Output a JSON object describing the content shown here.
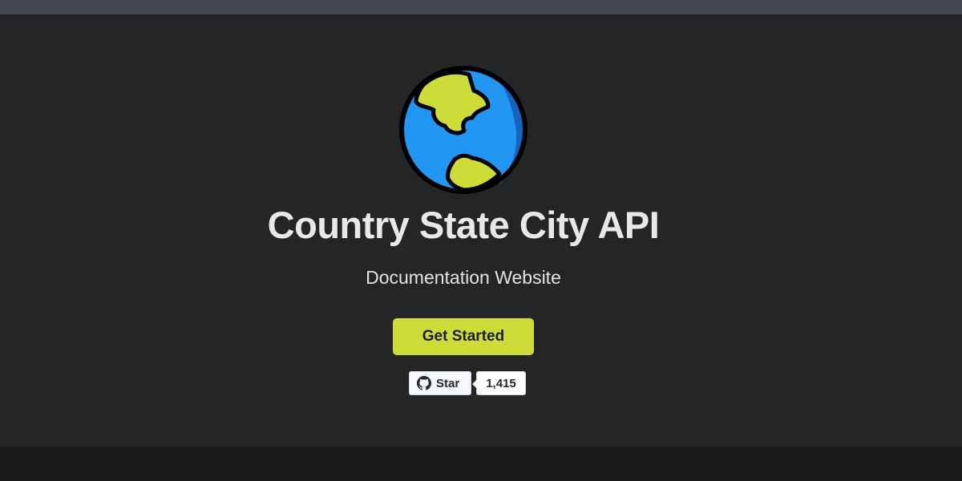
{
  "hero": {
    "title": "Country State City API",
    "subtitle": "Documentation Website",
    "cta_label": "Get Started",
    "logo_icon": "globe-icon"
  },
  "github": {
    "star_label": "Star",
    "star_count": "1,415",
    "icon": "github-icon"
  },
  "colors": {
    "accent": "#cddc39",
    "hero_background": "#242526",
    "navbar": "#444950",
    "footer": "#1b1b1d",
    "globe_ocean": "#2196f3",
    "globe_land": "#cddc39"
  }
}
